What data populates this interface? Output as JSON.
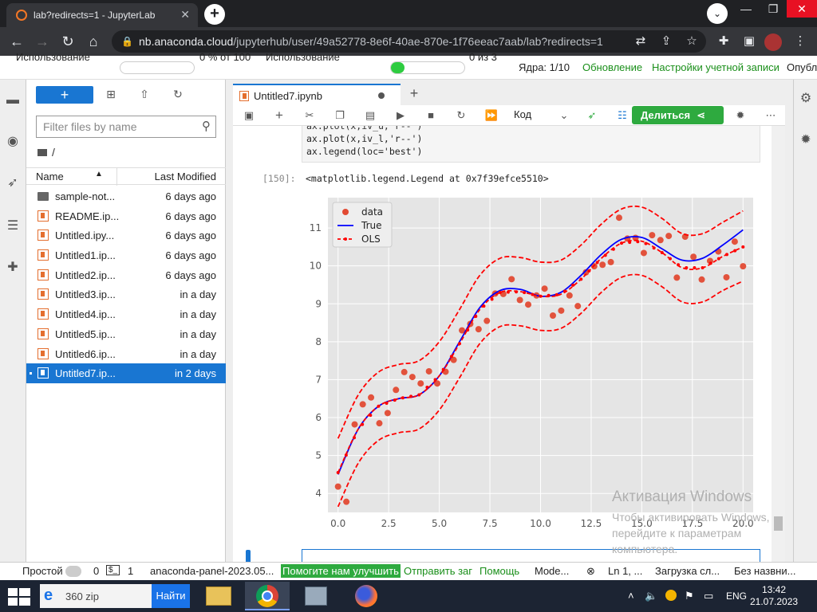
{
  "browser": {
    "tab_title": "lab?redirects=1 - JupyterLab",
    "url_prefix": "nb.anaconda.cloud",
    "url_path": "/jupyterhub/user/49a52778-8e6f-40ae-870e-1f76eeac7aab/lab?redirects=1"
  },
  "topstrip": {
    "usage_label_1": "Использование",
    "usage_value_1": "0 % от 100",
    "usage_label_2": "Использование",
    "usage_value_2": "0 из 3",
    "usage_fill_2": 0.18,
    "kernels": "Ядра: 1/10",
    "update": "Обновление",
    "account_settings": "Настройки учетной записи",
    "publish": "Опубл"
  },
  "filebrowser": {
    "new_label": "+",
    "filter_placeholder": "Filter files by name",
    "breadcrumb": "/",
    "col_name": "Name",
    "col_modified": "Last Modified",
    "files": [
      {
        "name": "sample-not...",
        "modified": "6 days ago",
        "type": "folder"
      },
      {
        "name": "README.ip...",
        "modified": "6 days ago",
        "type": "notebook"
      },
      {
        "name": "Untitled.ipy...",
        "modified": "6 days ago",
        "type": "notebook"
      },
      {
        "name": "Untitled1.ip...",
        "modified": "6 days ago",
        "type": "notebook"
      },
      {
        "name": "Untitled2.ip...",
        "modified": "6 days ago",
        "type": "notebook"
      },
      {
        "name": "Untitled3.ip...",
        "modified": "in a day",
        "type": "notebook"
      },
      {
        "name": "Untitled4.ip...",
        "modified": "in a day",
        "type": "notebook"
      },
      {
        "name": "Untitled5.ip...",
        "modified": "in a day",
        "type": "notebook"
      },
      {
        "name": "Untitled6.ip...",
        "modified": "in a day",
        "type": "notebook"
      },
      {
        "name": "Untitled7.ip...",
        "modified": "in 2 days",
        "type": "notebook",
        "selected": true
      }
    ]
  },
  "notebook": {
    "tab_title": "Untitled7.ipynb",
    "kernel_mode": "Код",
    "share_label": "Делиться",
    "code_lines": [
      "ax.plot(x,iv_l,'r--')",
      "ax.legend(loc='best')"
    ],
    "out_prompt": "[150]:",
    "out_text": "<matplotlib.legend.Legend at 0x7f39efce5510>"
  },
  "chart_data": {
    "type": "line",
    "xlim": [
      -0.5,
      20.5
    ],
    "ylim": [
      3.5,
      11.8
    ],
    "xticks": [
      "0.0",
      "2.5",
      "5.0",
      "7.5",
      "10.0",
      "12.5",
      "15.0",
      "17.5",
      "20.0"
    ],
    "yticks": [
      "4",
      "5",
      "6",
      "7",
      "8",
      "9",
      "10",
      "11"
    ],
    "legend": [
      "data",
      "True",
      "OLS"
    ],
    "legend_position": "upper left",
    "grid": true,
    "colors": {
      "data": "#e24a33",
      "true": "#0000ff",
      "ols": "#ff0000",
      "bg": "#e5e5e5"
    },
    "series": [
      {
        "name": "data",
        "style": "scatter",
        "x": [
          0.0,
          0.41,
          0.82,
          1.22,
          1.63,
          2.04,
          2.45,
          2.86,
          3.27,
          3.67,
          4.08,
          4.49,
          4.9,
          5.31,
          5.71,
          6.12,
          6.53,
          6.94,
          7.35,
          7.76,
          8.16,
          8.57,
          8.98,
          9.39,
          9.8,
          10.2,
          10.61,
          11.02,
          11.43,
          11.84,
          12.24,
          12.65,
          13.06,
          13.47,
          13.88,
          14.29,
          14.69,
          15.1,
          15.51,
          15.92,
          16.33,
          16.73,
          17.14,
          17.55,
          17.96,
          18.37,
          18.78,
          19.18,
          19.59,
          20.0
        ],
        "y": [
          4.18,
          3.78,
          5.82,
          6.35,
          6.53,
          5.85,
          6.12,
          6.73,
          7.2,
          7.07,
          6.9,
          7.22,
          6.9,
          7.21,
          7.52,
          8.3,
          8.47,
          8.33,
          8.55,
          9.27,
          9.26,
          9.65,
          9.1,
          8.98,
          9.22,
          9.4,
          8.69,
          8.82,
          9.22,
          8.94,
          9.83,
          9.99,
          10.03,
          10.1,
          11.27,
          10.72,
          10.74,
          10.34,
          10.81,
          10.68,
          10.79,
          9.69,
          10.77,
          10.24,
          9.64,
          10.13,
          10.38,
          9.7,
          10.64,
          9.99
        ]
      },
      {
        "name": "True",
        "style": "line",
        "x": [
          0,
          1,
          2,
          3,
          4,
          5,
          6,
          7,
          8,
          9,
          10,
          11,
          12,
          13,
          14,
          15,
          16,
          17,
          18,
          19,
          20
        ],
        "y": [
          4.5,
          5.7,
          6.3,
          6.5,
          6.6,
          7.1,
          8.0,
          8.9,
          9.35,
          9.38,
          9.2,
          9.3,
          9.75,
          10.3,
          10.7,
          10.75,
          10.45,
          10.15,
          10.2,
          10.55,
          10.95
        ]
      },
      {
        "name": "OLS",
        "style": "dashed-dotted",
        "x": [
          0,
          1,
          2,
          3,
          4,
          5,
          6,
          7,
          8,
          9,
          10,
          11,
          12,
          13,
          14,
          15,
          16,
          17,
          18,
          19,
          20
        ],
        "y": [
          4.55,
          5.7,
          6.3,
          6.5,
          6.6,
          7.1,
          7.95,
          8.85,
          9.3,
          9.32,
          9.2,
          9.25,
          9.65,
          10.2,
          10.6,
          10.65,
          10.35,
          9.95,
          9.95,
          10.25,
          10.5
        ]
      },
      {
        "name": "iv_u",
        "style": "dashed",
        "x": [
          0,
          1,
          2,
          3,
          4,
          5,
          6,
          7,
          8,
          9,
          10,
          11,
          12,
          13,
          14,
          15,
          16,
          17,
          18,
          19,
          20
        ],
        "y": [
          5.45,
          6.6,
          7.2,
          7.4,
          7.5,
          8.0,
          8.85,
          9.75,
          10.2,
          10.22,
          10.1,
          10.15,
          10.55,
          11.1,
          11.5,
          11.55,
          11.25,
          10.85,
          10.85,
          11.15,
          11.45
        ]
      },
      {
        "name": "iv_l",
        "style": "dashed",
        "x": [
          0,
          1,
          2,
          3,
          4,
          5,
          6,
          7,
          8,
          9,
          10,
          11,
          12,
          13,
          14,
          15,
          16,
          17,
          18,
          19,
          20
        ],
        "y": [
          3.65,
          4.8,
          5.4,
          5.6,
          5.7,
          6.2,
          7.05,
          7.95,
          8.4,
          8.42,
          8.3,
          8.35,
          8.75,
          9.3,
          9.7,
          9.75,
          9.45,
          9.05,
          9.05,
          9.35,
          9.6
        ]
      }
    ]
  },
  "watermark": {
    "line1": "Активация Windows",
    "line2": "Чтобы активировать Windows, перейдите к параметрам компьютера."
  },
  "statusbar": {
    "mode": "Простой",
    "n1": "0",
    "n2": "1",
    "panel": "anaconda-panel-2023.05...",
    "help_improve": "Помогите нам улучшить",
    "report_bug": "Отправить заг",
    "help": "Помощь",
    "mode2": "Mode...",
    "lncol": "Ln 1, ...",
    "loading": "Загрузка сл...",
    "untitled": "Без назвни..."
  },
  "taskbar": {
    "search_text": "360 zip",
    "search_button": "Найти",
    "lang": "ENG",
    "time": "13:42",
    "date": "21.07.2023"
  }
}
